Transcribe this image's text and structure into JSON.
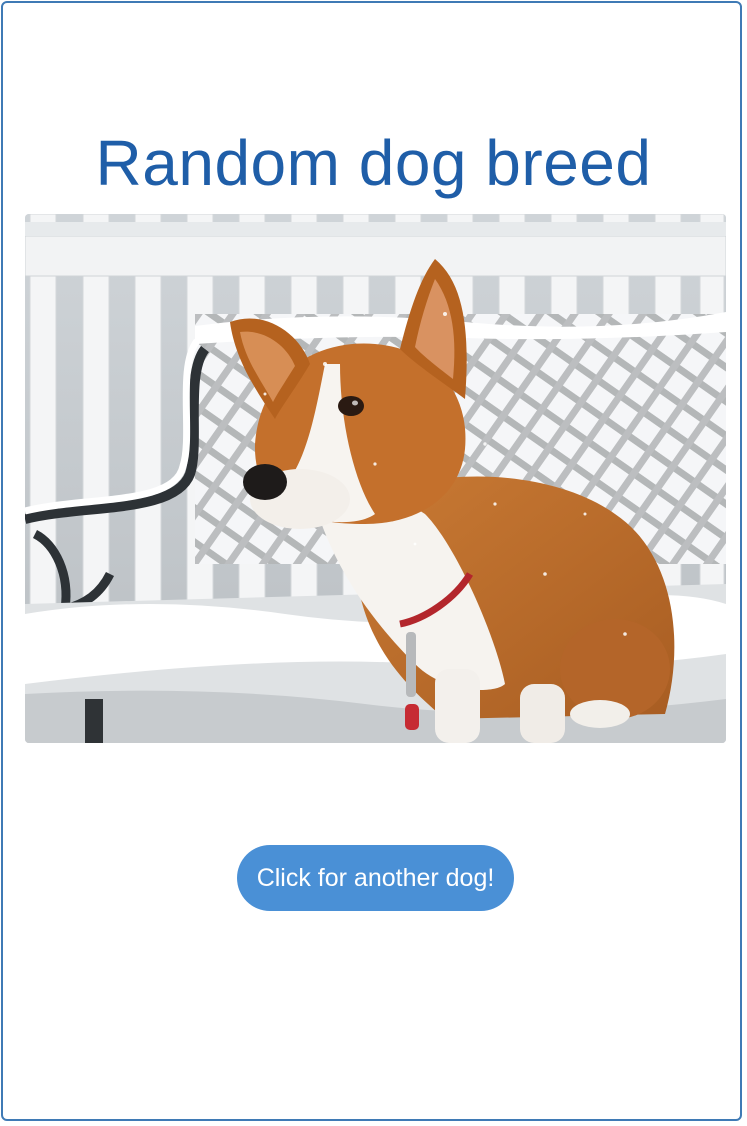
{
  "page": {
    "title": "Random dog breed",
    "button_label": "Click for another dog!"
  },
  "image": {
    "subject": "corgi-dog-on-snowy-bench"
  },
  "colors": {
    "border": "#3f7ab5",
    "title": "#1f5ea8",
    "button_bg": "#4a90d6",
    "button_text": "#ffffff"
  }
}
